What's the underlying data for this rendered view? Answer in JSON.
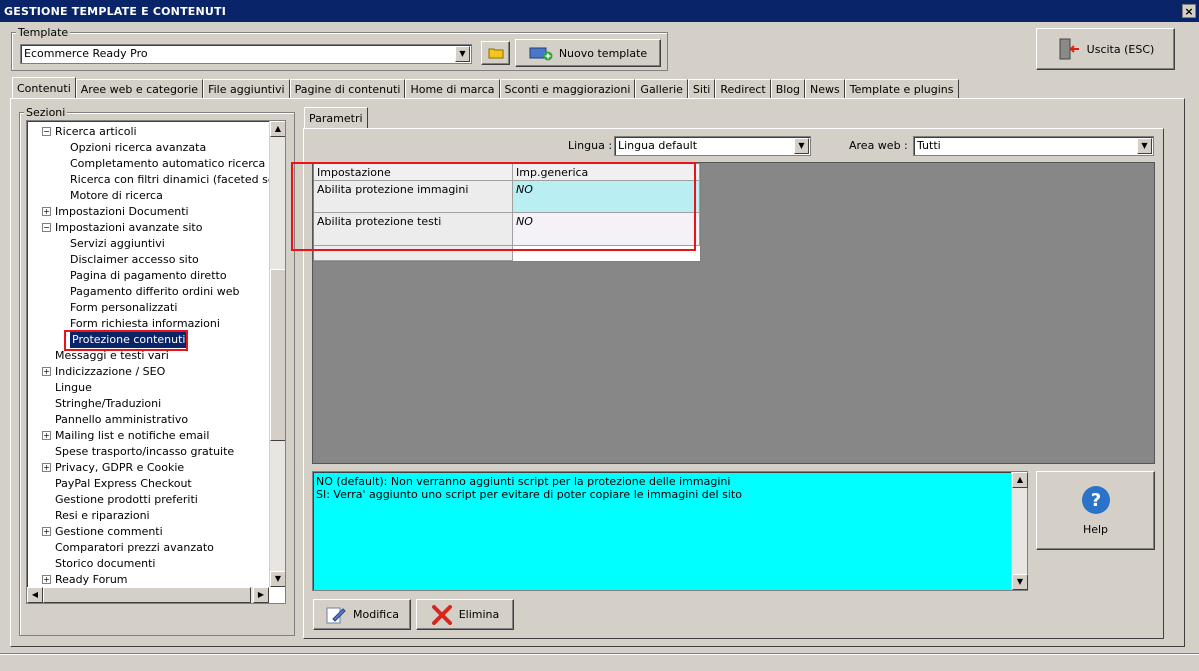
{
  "window": {
    "title": "GESTIONE TEMPLATE E CONTENUTI",
    "close_glyph": "×"
  },
  "template": {
    "group_label": "Template",
    "selected": "Ecommerce Ready Pro",
    "new_button": "Nuovo template"
  },
  "exit_button": "Uscita (ESC)",
  "tabs": [
    "Contenuti",
    "Aree web e categorie",
    "File aggiuntivi",
    "Pagine di contenuti",
    "Home di marca",
    "Sconti e maggiorazioni",
    "Gallerie",
    "Siti",
    "Redirect",
    "Blog",
    "News",
    "Template e plugins"
  ],
  "sections": {
    "label": "Sezioni",
    "items": [
      {
        "label": "Ricerca articoli",
        "level": 1,
        "expander": "minus"
      },
      {
        "label": "Opzioni ricerca avanzata",
        "level": 2
      },
      {
        "label": "Completamento automatico ricerca",
        "level": 2
      },
      {
        "label": "Ricerca con filtri dinamici (faceted search)",
        "level": 2
      },
      {
        "label": "Motore di ricerca",
        "level": 2
      },
      {
        "label": "Impostazioni Documenti",
        "level": 1,
        "expander": "plus"
      },
      {
        "label": "Impostazioni avanzate sito",
        "level": 1,
        "expander": "minus"
      },
      {
        "label": "Servizi aggiuntivi",
        "level": 2
      },
      {
        "label": "Disclaimer accesso sito",
        "level": 2
      },
      {
        "label": "Pagina di pagamento diretto",
        "level": 2
      },
      {
        "label": "Pagamento differito ordini web",
        "level": 2
      },
      {
        "label": "Form personalizzati",
        "level": 2
      },
      {
        "label": "Form richiesta informazioni",
        "level": 2
      },
      {
        "label": "Protezione contenuti",
        "level": 2,
        "selected": true
      },
      {
        "label": "Messaggi e testi vari",
        "level": 1
      },
      {
        "label": "Indicizzazione / SEO",
        "level": 1,
        "expander": "plus"
      },
      {
        "label": "Lingue",
        "level": 1
      },
      {
        "label": "Stringhe/Traduzioni",
        "level": 1
      },
      {
        "label": "Pannello amministrativo",
        "level": 1
      },
      {
        "label": "Mailing list e notifiche email",
        "level": 1,
        "expander": "plus"
      },
      {
        "label": "Spese trasporto/incasso gratuite",
        "level": 1
      },
      {
        "label": "Privacy, GDPR e Cookie",
        "level": 1,
        "expander": "plus"
      },
      {
        "label": "PayPal Express Checkout",
        "level": 1
      },
      {
        "label": "Gestione prodotti preferiti",
        "level": 1
      },
      {
        "label": "Resi e riparazioni",
        "level": 1
      },
      {
        "label": "Gestione commenti",
        "level": 1,
        "expander": "plus"
      },
      {
        "label": "Comparatori prezzi avanzato",
        "level": 1
      },
      {
        "label": "Storico documenti",
        "level": 1
      },
      {
        "label": "Ready Forum",
        "level": 1,
        "expander": "plus"
      }
    ]
  },
  "params": {
    "tab": "Parametri",
    "lingua_label": "Lingua :",
    "lingua_value": "Lingua default",
    "area_label": "Area web :",
    "area_value": "Tutti",
    "columns": [
      "Impostazione",
      "Imp.generica"
    ],
    "rows": [
      {
        "name": "Abilita protezione immagini",
        "value": "NO"
      },
      {
        "name": "Abilita protezione testi",
        "value": "NO"
      }
    ]
  },
  "description": {
    "line1": "NO (default): Non verranno aggiunti script per la protezione delle immagini",
    "line2": "SI: Verra' aggiunto uno script per evitare di poter copiare le immagini del sito"
  },
  "help_button": "Help",
  "modifica_button": "Modifica",
  "elimina_button": "Elimina"
}
